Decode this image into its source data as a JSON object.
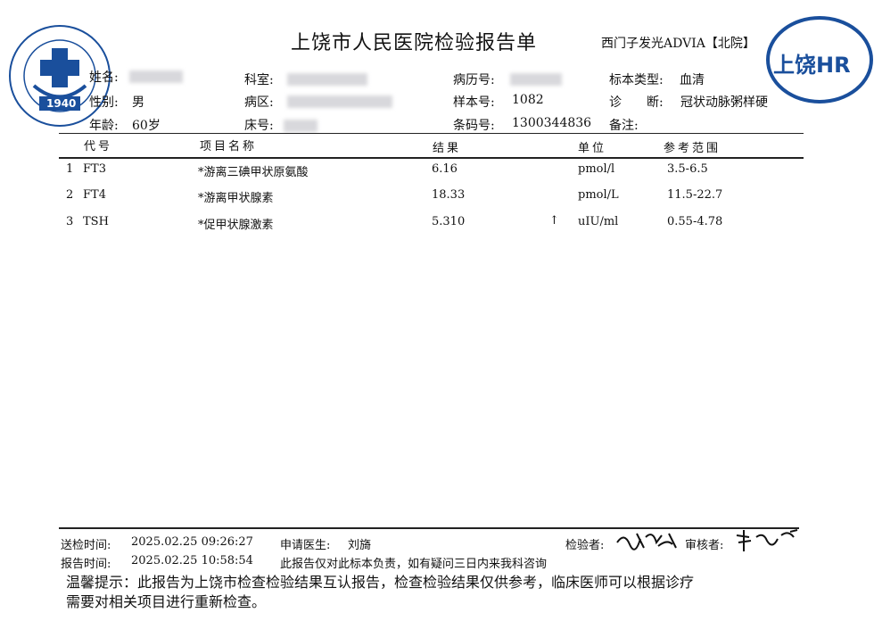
{
  "header": {
    "title": "上饶市人民医院检验报告单",
    "device": "西门子发光ADVIA【北院】",
    "logo_left_text": "1940",
    "logo_right_text": "上饶HR"
  },
  "patient": {
    "name_label": "姓名:",
    "gender_label": "性别:",
    "gender": "男",
    "age_label": "年龄:",
    "age": "60岁",
    "dept_label": "科室:",
    "ward_label": "病区:",
    "bed_label": "床号:",
    "record_label": "病历号:",
    "sample_label": "样本号:",
    "sample": "1082",
    "barcode_label": "条码号:",
    "barcode": "1300344836",
    "specimen_label": "标本类型:",
    "specimen": "血清",
    "diagnosis_label": "诊　　断:",
    "diagnosis": "冠状动脉粥样硬",
    "note_label": "备注:"
  },
  "table": {
    "headers": {
      "code": "代号",
      "name": "项目名称",
      "result": "结果",
      "unit": "单位",
      "range": "参考范围"
    },
    "rows": [
      {
        "index": "1",
        "code": "FT3",
        "name": "*游离三碘甲状原氨酸",
        "result": "6.16",
        "flag": "",
        "unit": "pmol/l",
        "range": "3.5-6.5"
      },
      {
        "index": "2",
        "code": "FT4",
        "name": "*游离甲状腺素",
        "result": "18.33",
        "flag": "",
        "unit": "pmol/L",
        "range": "11.5-22.7"
      },
      {
        "index": "3",
        "code": "TSH",
        "name": "*促甲状腺激素",
        "result": "5.310",
        "flag": "↑",
        "unit": "uIU/ml",
        "range": "0.55-4.78"
      }
    ]
  },
  "footer": {
    "send_time_label": "送检时间:",
    "send_time": "2025.02.25 09:26:27",
    "doctor_label": "申请医生:",
    "doctor": "刘旖",
    "report_time_label": "报告时间:",
    "report_time": "2025.02.25 10:58:54",
    "disclaimer": "此报告仅对此标本负责，如有疑问三日内来我科咨询",
    "tester_label": "检验者:",
    "reviewer_label": "审核者:",
    "tip_line1": "温馨提示：此报告为上饶市检查检验结果互认报告，检查检验结果仅供参考，临床医师可以根据诊疗",
    "tip_line2": "需要对相关项目进行重新检查。"
  },
  "colors": {
    "logo_blue": "#1a4f9c",
    "blur_gray": "#d8d8dc"
  }
}
